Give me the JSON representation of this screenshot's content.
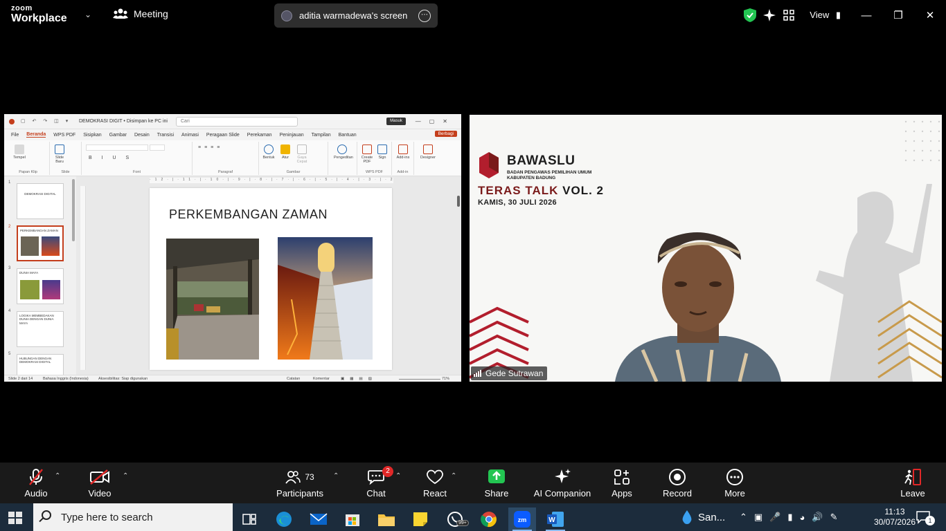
{
  "topbar": {
    "logo_line1": "zoom",
    "logo_line2": "Workplace",
    "meeting_label": "Meeting",
    "share_label": "aditia warmadewa's screen",
    "view_label": "View"
  },
  "ppt": {
    "doc_title": "DEMOKRASI DIGIT • Disimpan ke PC ini",
    "search_placeholder": "Cari",
    "signin_label": "Masuk",
    "share_label": "Berbagi",
    "menu": [
      "File",
      "Beranda",
      "WPS PDF",
      "Sisipkan",
      "Gambar",
      "Desain",
      "Transisi",
      "Animasi",
      "Peragaan Slide",
      "Perekaman",
      "Peninjauan",
      "Tampilan",
      "Bantuan"
    ],
    "ribbon_buttons": [
      "Tempel",
      "Slide Baru",
      "Bentuk",
      "Atur",
      "Gaya Cepat",
      "Pengeditan",
      "Create PDF",
      "Sign",
      "Add-ins",
      "Designer"
    ],
    "ribbon_groups": [
      "Papan Klip",
      "Slide",
      "Font",
      "Paragraf",
      "Gambar",
      "WPS PDF",
      "Add-in"
    ],
    "thumbnails": [
      {
        "num": "1",
        "title": "DEMOKRASI DIGITAL"
      },
      {
        "num": "2",
        "title": "PERKEMBANGAN ZAMAN"
      },
      {
        "num": "3",
        "title": "DUNIA MAYA"
      },
      {
        "num": "4",
        "title": "LOGIKA MEMBEDAKAN DUNIA DENGAN DUNIA MAYA"
      },
      {
        "num": "5",
        "title": "HUBUNGAN DENGAN DEMOKRASI DIGITAL"
      }
    ],
    "ruler_text": "·12·|·11·|·10·|·9·|·8·|·7·|·6·|·5·|·4·|·3·|·2·|·1·|·0·|·1·|·2·|·3·|·4·|·5·|·6·|·7·|·8·|·9·|·10·|·11·|·12",
    "slide_title": "PERKEMBANGAN ZAMAN",
    "status": {
      "slide_count": "Slide 2 dari 14",
      "language": "Bahasa Inggris (Indonesia)",
      "accessibility": "Aksesibilitas: Siap digunakan",
      "notes": "Catatan",
      "comments": "Komentar",
      "zoom": "71%"
    }
  },
  "video": {
    "brand_name": "BAWASLU",
    "brand_sub1": "BADAN PENGAWAS PEMILIHAN UMUM",
    "brand_sub2": "KABUPATEN BADUNG",
    "event_title": "TERAS TALK",
    "event_vol": "VOL. 2",
    "event_date": "KAMIS, 30 JULI 2026",
    "participant_name": "Gede Sutrawan"
  },
  "toolbar": {
    "audio": "Audio",
    "video": "Video",
    "participants": "Participants",
    "participants_count": "73",
    "chat": "Chat",
    "chat_badge": "2",
    "react": "React",
    "share": "Share",
    "ai_companion": "AI Companion",
    "apps": "Apps",
    "record": "Record",
    "more": "More",
    "leave": "Leave"
  },
  "taskbar": {
    "search_placeholder": "Type here to search",
    "weather_label": "San...",
    "time": "11:13",
    "date": "30/07/2026",
    "notification_count": "1",
    "whatsapp_badge": "99+"
  },
  "colors": {
    "zoom_green": "#23c552",
    "ppt_accent": "#c43e1c",
    "bawaslu_red": "#7a1a1a",
    "chevron_gold": "#c89a4b",
    "chevron_red": "#b21e2d"
  }
}
